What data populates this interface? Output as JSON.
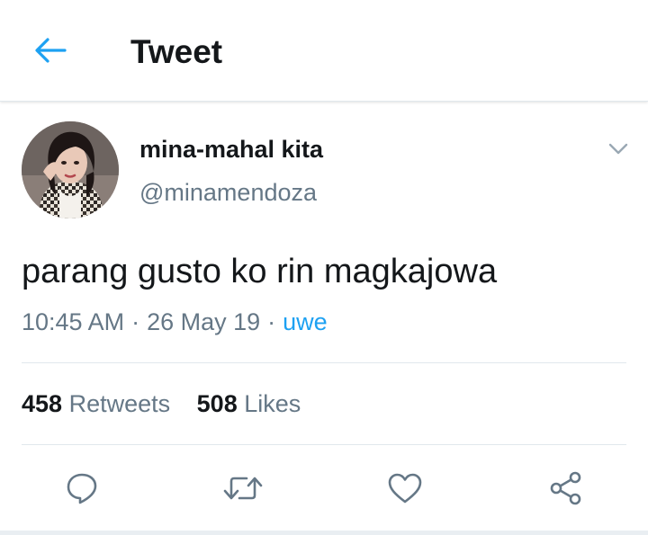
{
  "header": {
    "title": "Tweet",
    "back_icon": "back-arrow-icon",
    "accent": "#1da1f2"
  },
  "tweet": {
    "author": {
      "display_name": "mina-mahal kita",
      "handle": "@minamendoza"
    },
    "text": "parang gusto ko rin magkajowa",
    "time": "10:45 AM",
    "date": "26 May 19",
    "separator": "·",
    "client": "uwe",
    "stats": {
      "retweets_count": "458",
      "retweets_label": "Retweets",
      "likes_count": "508",
      "likes_label": "Likes"
    },
    "actions": [
      "reply-icon",
      "retweet-icon",
      "like-icon",
      "share-icon"
    ]
  },
  "colors": {
    "text": "#14171a",
    "muted": "#657786",
    "link": "#1da1f2",
    "divider": "#e1e8ed"
  }
}
